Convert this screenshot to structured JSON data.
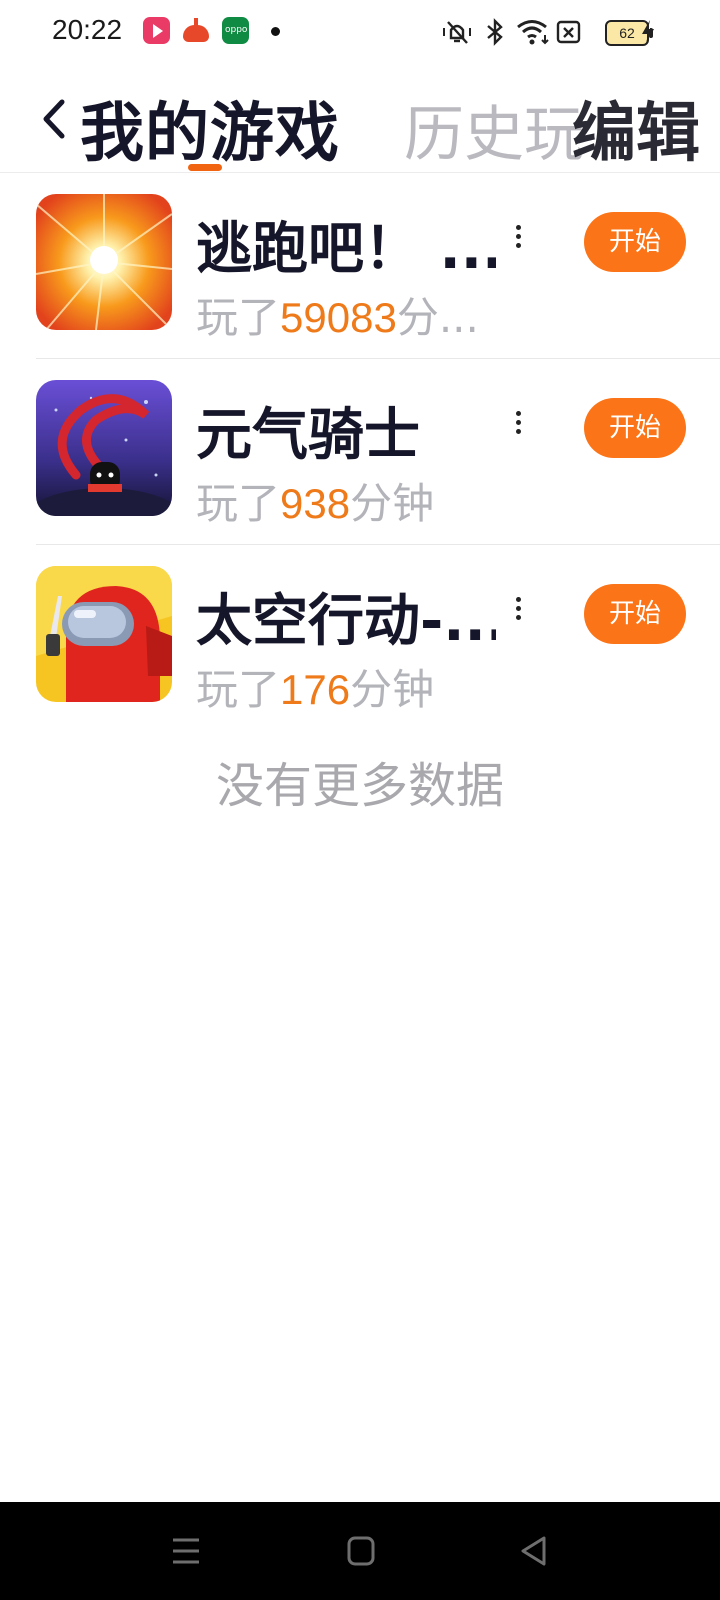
{
  "status_bar": {
    "time": "20:22",
    "battery": "62",
    "icons": [
      "video-app-icon",
      "pumpkin-app-icon",
      "oppo-app-icon",
      "notification-dot",
      "vibrate-mute-icon",
      "bluetooth-icon",
      "wifi-icon",
      "sim-x-icon",
      "battery-icon",
      "charging-icon"
    ]
  },
  "header": {
    "tabs": [
      "我的游戏",
      "历史玩"
    ],
    "active_tab": "我的游戏",
    "edit_label": "编辑",
    "accent": "#f06412"
  },
  "games": [
    {
      "name": "逃跑吧！ ...",
      "played_prefix": "玩了",
      "minutes": "59083",
      "played_suffix": "分...",
      "start_label": "开始"
    },
    {
      "name": "元气骑士",
      "played_prefix": "玩了",
      "minutes": "938",
      "played_suffix": "分钟",
      "start_label": "开始"
    },
    {
      "name": "太空行动-...",
      "played_prefix": "玩了",
      "minutes": "176",
      "played_suffix": "分钟",
      "start_label": "开始"
    }
  ],
  "empty_text": "没有更多数据",
  "colors": {
    "button": "#fb7417",
    "minutes": "#ee7a1a"
  }
}
